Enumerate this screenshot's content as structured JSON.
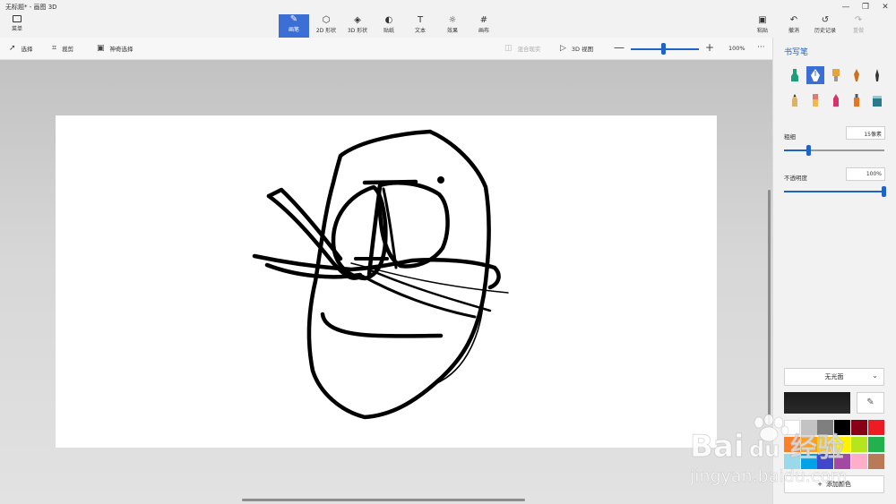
{
  "window": {
    "title": "无标题* - 画图 3D",
    "minimize_glyph": "—",
    "maximize_glyph": "❐",
    "close_glyph": "✕"
  },
  "ribbon": {
    "menu_label": "菜单",
    "tools": [
      {
        "label": "画笔",
        "icon": "brush-icon",
        "glyph": "✎"
      },
      {
        "label": "2D 形状",
        "icon": "shapes-2d-icon",
        "glyph": "⬡"
      },
      {
        "label": "3D 形状",
        "icon": "cube-icon",
        "glyph": "◈"
      },
      {
        "label": "贴纸",
        "icon": "sticker-icon",
        "glyph": "◐"
      },
      {
        "label": "文本",
        "icon": "text-icon",
        "glyph": "T"
      },
      {
        "label": "效果",
        "icon": "effects-icon",
        "glyph": "☼"
      },
      {
        "label": "画布",
        "icon": "canvas-icon",
        "glyph": "#"
      }
    ],
    "right": [
      {
        "label": "粘贴",
        "icon": "paste-icon",
        "glyph": "▣"
      },
      {
        "label": "撤消",
        "icon": "undo-icon",
        "glyph": "↶"
      },
      {
        "label": "历史记录",
        "icon": "history-icon",
        "glyph": "↺"
      },
      {
        "label": "重做",
        "icon": "redo-icon",
        "glyph": "↷"
      }
    ]
  },
  "toolbar2": {
    "select": "选择",
    "crop": "裁剪",
    "magic_select": "神奇选择",
    "mixed_reality": "混合现实",
    "view_3d": "3D 视图",
    "zoom": "100%",
    "zoom_level": 0.45,
    "more_glyph": "···",
    "minus_glyph": "—",
    "plus_glyph": "+"
  },
  "panel": {
    "title": "书写笔",
    "brushes": [
      {
        "name": "marker",
        "color": "#1f9e7a"
      },
      {
        "name": "calligraphy-pen",
        "color": "#2d5fa8"
      },
      {
        "name": "oil-brush",
        "color": "#e8a33b"
      },
      {
        "name": "watercolor",
        "color": "#c8741f"
      },
      {
        "name": "pixel-pen",
        "color": "#333333"
      },
      {
        "name": "pencil",
        "color": "#7a5a2e"
      },
      {
        "name": "eraser",
        "color": "#e07a6f"
      },
      {
        "name": "crayon",
        "color": "#d6336c"
      },
      {
        "name": "spray-can",
        "color": "#e8741f"
      },
      {
        "name": "fill",
        "color": "#2a7a8a"
      }
    ],
    "thickness_label": "粗细",
    "thickness_value": "15像素",
    "thickness_level": 0.24,
    "opacity_label": "不透明度",
    "opacity_value": "100%",
    "opacity_level": 1.0,
    "finish": "无光面",
    "current_color": "#1b1b1b",
    "add_color": "添加颜色",
    "swatches": [
      "#ffffff",
      "#c3c3c3",
      "#7f7f7f",
      "#000000",
      "#880015",
      "#ed1c24",
      "#ff7f27",
      "#ff9f1c",
      "#ffc90e",
      "#fff200",
      "#b5e61d",
      "#22b14c",
      "#99d9ea",
      "#00a2e8",
      "#3f48cc",
      "#a349a4",
      "#ffaec9",
      "#b97a57"
    ]
  },
  "watermark": {
    "brand": "Bai",
    "paw": "du",
    "cn": "经验",
    "url": "jingyan.baidu.com"
  }
}
